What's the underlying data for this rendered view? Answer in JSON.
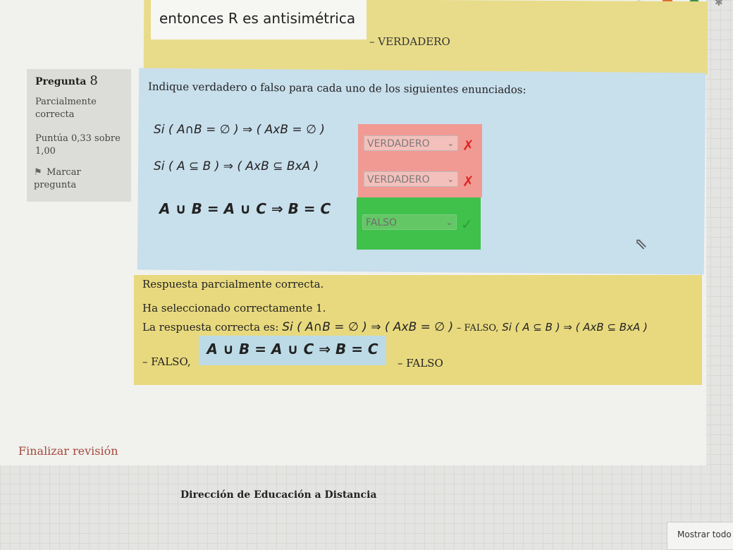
{
  "previous": {
    "text": "entonces R es antisimétrica",
    "answer": "– VERDADERO"
  },
  "info": {
    "question_word": "Pregunta",
    "question_number": "8",
    "state": "Parcialmente correcta",
    "grade": "Puntúa 0,33 sobre 1,00",
    "flag_label": "Marcar pregunta"
  },
  "question": {
    "prompt": "Indique verdadero o falso para cada uno de los siguientes enunciados:",
    "statements": [
      {
        "text": "Si ( A∩B = ∅ ) ⇒ ( AxB = ∅ )",
        "selected": "VERDADERO",
        "result": "incorrect"
      },
      {
        "text": "Si ( A ⊆ B ) ⇒ ( AxB ⊆ BxA )",
        "selected": "VERDADERO",
        "result": "incorrect"
      },
      {
        "text": "A ∪ B = A ∪ C ⇒ B = C",
        "selected": "FALSO",
        "result": "correct"
      }
    ]
  },
  "marks": {
    "incorrect": "✗",
    "correct": "✓",
    "chevron": "⌄"
  },
  "feedback": {
    "line1": "Respuesta parcialmente correcta.",
    "line2": "Ha seleccionado correctamente 1.",
    "line3_prefix": "La respuesta correcta es:",
    "line3_formula1": "Si ( A∩B = ∅ ) ⇒ ( AxB = ∅ )",
    "line3_mid": "– FALSO,",
    "line3_formula2": "Si ( A ⊆ B ) ⇒ ( AxB ⊆ BxA )",
    "line4_prefix": "– FALSO,",
    "line4_formula": "A ∪ B = A ∪ C ⇒ B = C",
    "line4_suffix": "– FALSO"
  },
  "links": {
    "finalize": "Finalizar revisión",
    "footer": "Dirección de Educación a Distancia",
    "show_all": "Mostrar todo"
  },
  "colors": {
    "incorrect_bg": "#f19a94",
    "correct_bg": "#3fc14b",
    "feedback_bg": "#e8d97e",
    "question_bg": "#c8dfec"
  }
}
